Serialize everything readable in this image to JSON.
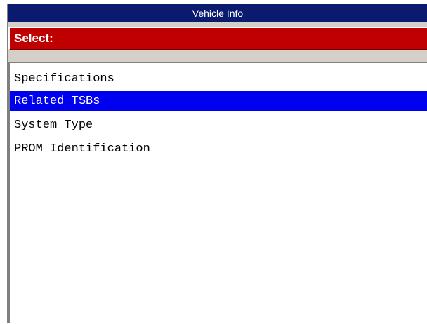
{
  "window": {
    "title": "Vehicle Info"
  },
  "header": {
    "label": "Select:"
  },
  "list": {
    "selected_index": 1,
    "items": [
      {
        "label": "Specifications"
      },
      {
        "label": "Related TSBs"
      },
      {
        "label": "System Type"
      },
      {
        "label": "PROM Identification"
      }
    ]
  },
  "colors": {
    "title_bar": "#0a1a6e",
    "header_bar": "#c00000",
    "selection": "#0000f0"
  }
}
